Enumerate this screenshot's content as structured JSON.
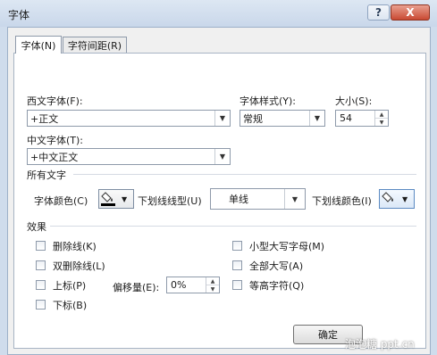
{
  "window": {
    "title": "字体",
    "help_label": "?",
    "close_label": "X"
  },
  "tabs": [
    {
      "label": "字体(N)"
    },
    {
      "label": "字符间距(R)"
    }
  ],
  "latin_font": {
    "label": "西文字体(F):",
    "value": "+正文"
  },
  "font_style": {
    "label": "字体样式(Y):",
    "value": "常规"
  },
  "size": {
    "label": "大小(S):",
    "value": "54"
  },
  "asian_font": {
    "label": "中文字体(T):",
    "value": "+中文正文"
  },
  "all_text": {
    "title": "所有文字",
    "font_color_label": "字体颜色(C)",
    "underline_style_label": "下划线线型(U)",
    "underline_style_value": "单线",
    "underline_color_label": "下划线颜色(I)"
  },
  "effects": {
    "title": "效果",
    "strikethrough": "删除线(K)",
    "double_strikethrough": "双删除线(L)",
    "superscript": "上标(P)",
    "subscript": "下标(B)",
    "offset_label": "偏移量(E):",
    "offset_value": "0%",
    "small_caps": "小型大写字母(M)",
    "all_caps": "全部大写(A)",
    "equalize_height": "等高字符(Q)"
  },
  "ok_label": "确定",
  "watermark": "泡泡糖 ppt.cn",
  "colors": {
    "title_bar": "#c9d7ea",
    "close_button": "#c94a33",
    "font_color_swatch": "#000000"
  }
}
